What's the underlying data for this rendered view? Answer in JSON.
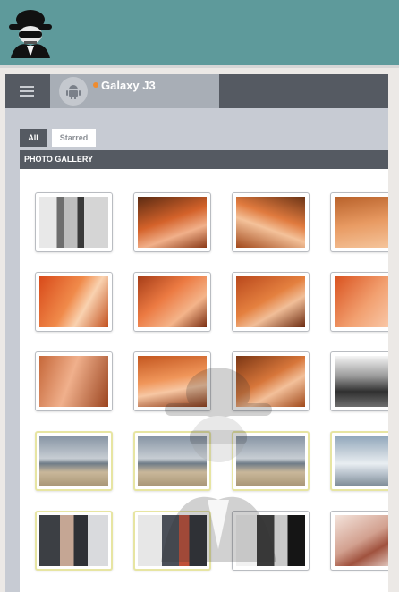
{
  "device": {
    "name": "Galaxy J3",
    "status_color": "#f08c2e"
  },
  "tabs": {
    "all": "All",
    "starred": "Starred"
  },
  "gallery": {
    "title": "PHOTO GALLERY",
    "thumbnails": [
      {
        "style": "lin-rotated",
        "selected": false
      },
      {
        "style": "warm-a",
        "selected": false
      },
      {
        "style": "warm-b",
        "selected": false
      },
      {
        "style": "warm-c",
        "selected": false
      },
      {
        "style": "warm-d",
        "selected": false
      },
      {
        "style": "warm-e",
        "selected": false
      },
      {
        "style": "warm-f",
        "selected": false
      },
      {
        "style": "warm-g",
        "selected": false
      },
      {
        "style": "warm-h",
        "selected": false
      },
      {
        "style": "warm-i",
        "selected": false
      },
      {
        "style": "warm-j",
        "selected": false
      },
      {
        "style": "mono-glass",
        "selected": false
      },
      {
        "style": "beach",
        "selected": true
      },
      {
        "style": "beach",
        "selected": true
      },
      {
        "style": "beach",
        "selected": true
      },
      {
        "style": "beach-rail",
        "selected": true
      },
      {
        "style": "street",
        "selected": true
      },
      {
        "style": "harbor",
        "selected": true
      },
      {
        "style": "rail-bw",
        "selected": false
      },
      {
        "style": "food",
        "selected": false
      }
    ]
  },
  "icons": {
    "logo": "spy-icon",
    "menu": "hamburger-menu-icon",
    "device": "android-icon",
    "watermark": "spy-watermark-icon"
  }
}
